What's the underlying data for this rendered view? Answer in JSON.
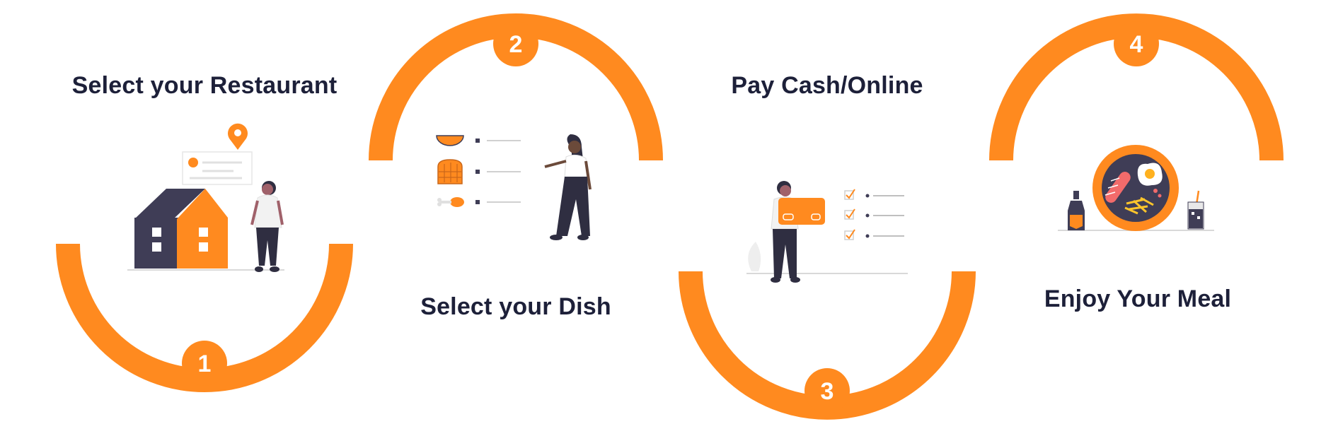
{
  "steps": [
    {
      "number": "1",
      "title": "Select your Restaurant"
    },
    {
      "number": "2",
      "title": "Select your Dish"
    },
    {
      "number": "3",
      "title": "Pay Cash/Online"
    },
    {
      "number": "4",
      "title": "Enjoy Your Meal"
    }
  ],
  "colors": {
    "accent": "#ff8a1f",
    "heading": "#1d2039",
    "dark": "#3f3d56"
  }
}
